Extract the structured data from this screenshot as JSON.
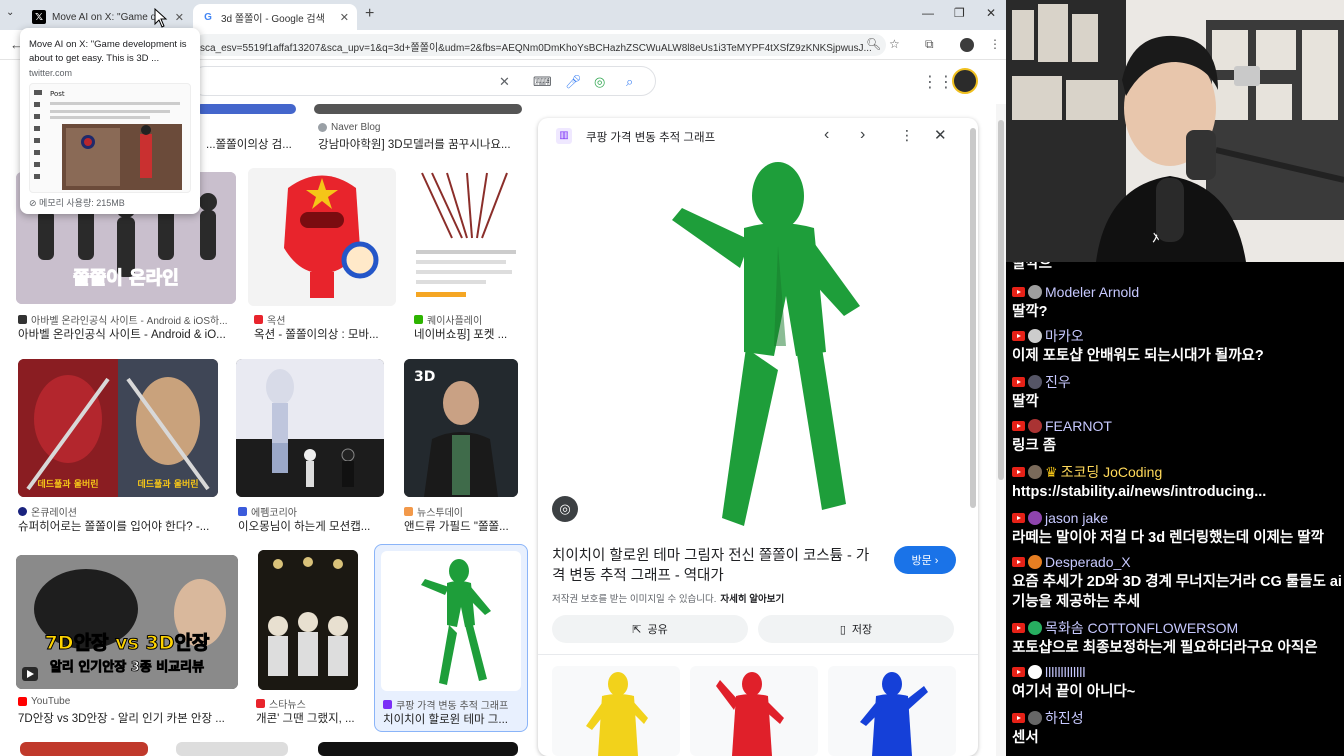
{
  "browser": {
    "tabs": [
      {
        "title": "Move AI on X: \"Game devel",
        "icon": "x-logo-icon"
      },
      {
        "title": "3d 쫄쫄이 - Google 검색",
        "icon": "google-g-icon"
      }
    ],
    "url": "sca_esv=5519f1affaf13207&sca_upv=1&q=3d+쫄쫄이&udm=2&fbs=AEQNm0DmKhoYsBCHazhZSCWuALW8l8eUs1i3TeMYPF4tXSfZ9zKNKSjpwusJ...",
    "tooltip": {
      "title": "Move AI on X: \"Game development is about to get easy. This is 3D ...",
      "host": "twitter.com",
      "memory": "메모리 사용량: 215MB",
      "preview_heading": "Post"
    }
  },
  "results": [
    {
      "source": "",
      "caption": "...쫄쫄이의상 검..."
    },
    {
      "source": "Naver Blog",
      "caption": "강남마야학원] 3D모델러를 꿈꾸시나요..."
    },
    {
      "source": "아바벨 온라인공식 사이트 - Android & iOS하...",
      "caption": "아바벨 온라인공식 사이트 - Android & iO..."
    },
    {
      "source": "옥션",
      "caption": "옥션 - 쫄쫄이의상 : 모바..."
    },
    {
      "source": "퀘이사플레이",
      "caption": "네이버쇼핑] 포켓 ..."
    },
    {
      "source": "온큐레이션",
      "caption": "슈퍼히어로는 쫄쫄이를 입어야 한다? -..."
    },
    {
      "source": "에펨코리아",
      "caption": "이오몽님이 하는게 모션캡..."
    },
    {
      "source": "뉴스투데이",
      "caption": "앤드류 가필드 \"쫄쫄..."
    },
    {
      "source": "YouTube",
      "caption": "7D안장 vs 3D안장 - 알리 인기 카본 안장 ..."
    },
    {
      "source": "스타뉴스",
      "caption": "개콘' 그땐 그랬지, ..."
    },
    {
      "source": "쿠팡 가격 변동 추적 그래프",
      "caption": "치이치이 할로윈 테마 그..."
    }
  ],
  "thumb_text": {
    "youtube_line1": "7D안장 vs 3D안장",
    "youtube_line2": "알리 인기안장 3종 비교리뷰",
    "poster_label": "데드풀과 울버린",
    "game_text": "쫄쫄이 온라인",
    "hangul_3d": "3D"
  },
  "panel": {
    "source_title": "쿠팡 가격 변동 추적 그래프",
    "name": "치이치이 할로윈 테마 그림자 전신 쫄쫄이 코스튬 - 가격 변동 추적 그래프 - 역대가",
    "visit_label": "방문 ›",
    "copyright": "저작권 보호를 받는 이미지일 수 있습니다.",
    "learn_more": "자세히 알아보기",
    "share_label": "공유",
    "save_label": "저장"
  },
  "chat": [
    {
      "user": "",
      "text": "딸깍으"
    },
    {
      "user": "Modeler Arnold",
      "text": "딸깍?"
    },
    {
      "user": "마카오",
      "text": "이제 포토샵 안배워도 되는시대가 될까요?"
    },
    {
      "user": "진우",
      "text": "딸깍"
    },
    {
      "user": "FEARNOT",
      "text": "링크 좀"
    },
    {
      "user": "조코딩 JoCoding",
      "text": "https://stability.ai/news/introducing..."
    },
    {
      "user": "jason jake",
      "text": "라떼는 말이야 저걸 다 3d 렌더링했는데 이제는 딸깍"
    },
    {
      "user": "Desperado_X",
      "text": "요즘 추세가 2D와 3D 경계 무너지는거라 CG 툴들도 ai",
      "text2": "기능을 제공하는 추세"
    },
    {
      "user": "목화솜 COTTONFLOWERSOM",
      "text": "포토샵으로 최종보정하는게 필요하더라구요 아직은"
    },
    {
      "user": "lllllllllllll",
      "text": "여기서 끝이 아니다~"
    },
    {
      "user": "하진성",
      "text": "센서"
    }
  ],
  "colors": {
    "tabstrip": "#dde3ea",
    "accent_blue": "#1a73e8",
    "suit_green": "#1e9e3a",
    "chat_bg": "#000000",
    "chat_name": "#c7c9ff"
  }
}
